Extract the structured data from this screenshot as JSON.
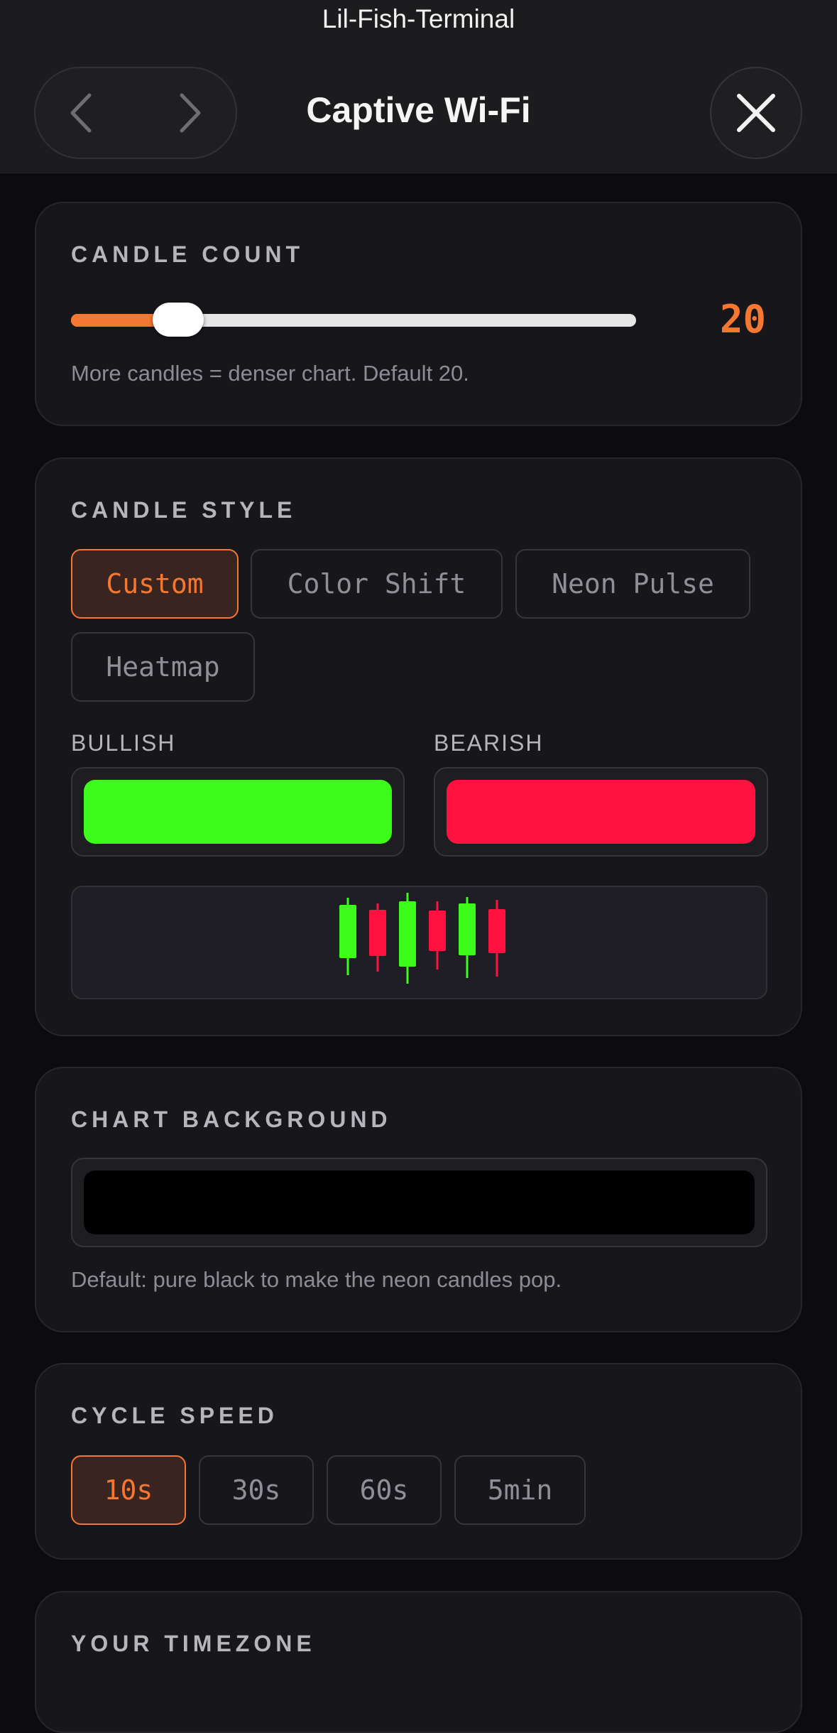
{
  "header": {
    "app_name": "Lil-Fish-Terminal",
    "title": "Captive Wi-Fi",
    "back_icon": "chevron-left-icon",
    "forward_icon": "chevron-right-icon",
    "close_icon": "close-icon"
  },
  "candle_count": {
    "title": "CANDLE COUNT",
    "value": "20",
    "slider_fraction": 0.19,
    "hint": "More candles = denser chart. Default 20.",
    "accent_color": "#f47732"
  },
  "candle_style": {
    "title": "CANDLE STYLE",
    "options": [
      "Custom",
      "Color Shift",
      "Neon Pulse",
      "Heatmap"
    ],
    "selected": "Custom",
    "bullish_label": "BULLISH",
    "bearish_label": "BEARISH",
    "bullish_color": "#3dfc1c",
    "bearish_color": "#ff1140",
    "preview_pattern": [
      "bullish",
      "bearish",
      "bullish",
      "bearish",
      "bullish",
      "bearish"
    ]
  },
  "chart_background": {
    "title": "CHART BACKGROUND",
    "color": "#000000",
    "hint": "Default: pure black to make the neon candles pop."
  },
  "cycle_speed": {
    "title": "CYCLE SPEED",
    "options": [
      "10s",
      "30s",
      "60s",
      "5min"
    ],
    "selected": "10s"
  },
  "timezone": {
    "title": "YOUR TIMEZONE"
  }
}
